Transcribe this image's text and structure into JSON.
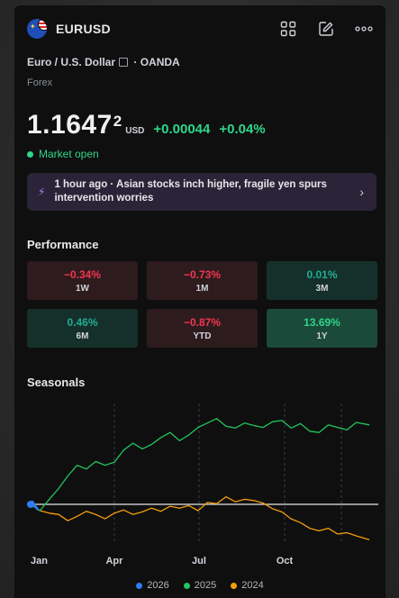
{
  "header": {
    "symbol": "EURUSD",
    "icons": [
      "grid-icon",
      "edit-icon",
      "more-icon"
    ]
  },
  "instrument": {
    "name": "Euro / U.S. Dollar",
    "separator": "·",
    "broker": "OANDA",
    "category": "Forex"
  },
  "quote": {
    "price_main": "1.1647",
    "price_fraction": "2",
    "currency": "USD",
    "change": "+0.00044",
    "change_pct": "+0.04%",
    "status": "Market open"
  },
  "news": {
    "text": "1 hour ago · Asian stocks inch higher, fragile yen spurs intervention worries"
  },
  "performance": {
    "title": "Performance",
    "cells": [
      {
        "value": "−0.34%",
        "label": "1W",
        "tone": "neg"
      },
      {
        "value": "−0.73%",
        "label": "1M",
        "tone": "neg"
      },
      {
        "value": "0.01%",
        "label": "3M",
        "tone": "pos"
      },
      {
        "value": "0.46%",
        "label": "6M",
        "tone": "pos"
      },
      {
        "value": "−0.87%",
        "label": "YTD",
        "tone": "neg"
      },
      {
        "value": "13.69%",
        "label": "1Y",
        "tone": "pos-strong"
      }
    ]
  },
  "seasonals": {
    "title": "Seasonals",
    "legend": [
      {
        "label": "2026",
        "color": "#2f7bf5"
      },
      {
        "label": "2025",
        "color": "#22c55e"
      },
      {
        "label": "2024",
        "color": "#f59e0b"
      }
    ]
  },
  "chart_data": {
    "type": "line",
    "x_ticks": [
      "Jan",
      "Apr",
      "Jul",
      "Oct"
    ],
    "baseline": 0,
    "ylim": [
      -6,
      16
    ],
    "grid": "vertical dashed at quarter marks",
    "legend_position": "bottom-center",
    "series": [
      {
        "name": "2026",
        "color": "#2f7bf5",
        "x": [
          0,
          2,
          5,
          8
        ],
        "y": [
          0,
          0.4,
          -0.3,
          -0.9
        ]
      },
      {
        "name": "2025",
        "color": "#22c55e",
        "x": [
          0,
          10,
          20,
          30,
          40,
          50,
          60,
          70,
          80,
          90,
          100,
          110,
          120,
          130,
          140,
          150,
          160,
          170,
          180,
          190,
          200,
          210,
          220,
          230,
          240,
          250,
          260,
          270,
          280,
          290,
          300,
          310,
          320,
          330,
          340,
          350,
          364
        ],
        "y": [
          0,
          -1.0,
          0.8,
          2.5,
          4.5,
          6.2,
          5.6,
          6.8,
          6.2,
          6.7,
          8.6,
          9.7,
          8.8,
          9.5,
          10.6,
          11.4,
          10.1,
          11.0,
          12.2,
          12.9,
          13.6,
          12.4,
          12.1,
          12.9,
          12.5,
          12.2,
          13.1,
          13.3,
          12.1,
          12.8,
          11.6,
          11.4,
          12.6,
          12.2,
          11.8,
          13.0,
          12.6
        ]
      },
      {
        "name": "2024",
        "color": "#f59e0b",
        "x": [
          0,
          10,
          20,
          30,
          40,
          50,
          60,
          70,
          80,
          90,
          100,
          110,
          120,
          130,
          140,
          150,
          160,
          170,
          180,
          190,
          200,
          210,
          220,
          230,
          240,
          250,
          260,
          270,
          280,
          290,
          300,
          310,
          320,
          330,
          340,
          350,
          364
        ],
        "y": [
          0,
          -1.0,
          -1.4,
          -1.6,
          -2.6,
          -1.9,
          -1.1,
          -1.6,
          -2.3,
          -1.4,
          -0.9,
          -1.6,
          -1.2,
          -0.6,
          -1.1,
          -0.3,
          -0.6,
          -0.2,
          -1.0,
          0.3,
          0.1,
          1.2,
          0.4,
          0.8,
          0.6,
          0.2,
          -0.7,
          -1.2,
          -2.3,
          -2.9,
          -3.8,
          -4.2,
          -3.8,
          -4.7,
          -4.5,
          -5.0,
          -5.6
        ]
      }
    ]
  }
}
